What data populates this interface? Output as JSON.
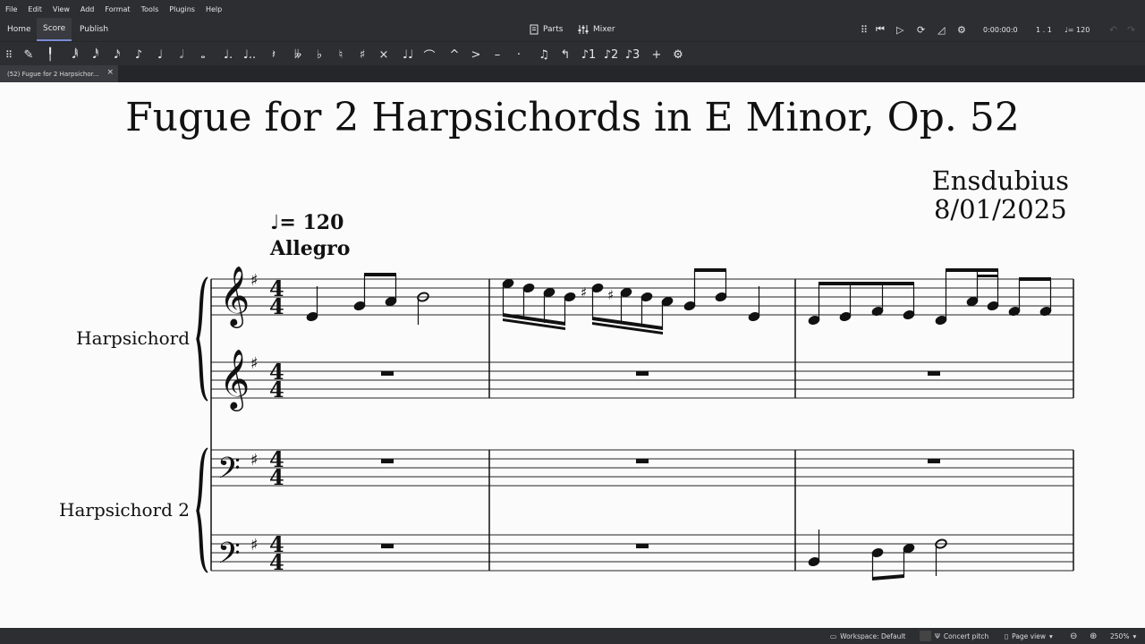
{
  "menu": [
    "File",
    "Edit",
    "View",
    "Add",
    "Format",
    "Tools",
    "Plugins",
    "Help"
  ],
  "tabs": {
    "home": "Home",
    "score": "Score",
    "publish": "Publish"
  },
  "center": {
    "parts": "Parts",
    "mixer": "Mixer"
  },
  "playback": {
    "time": "0:00:00:0",
    "position": "1 . 1",
    "tempo": "♩= 120"
  },
  "doc_tab": {
    "label": "(52) Fugue for 2 Harpsichor...",
    "close": "×"
  },
  "score": {
    "title": "Fugue for 2 Harpsichords in E Minor, Op. 52",
    "composer": "Ensdubius",
    "date": "8/01/2025",
    "tempo_marking": "= 120",
    "tempo_text": "Allegro",
    "instrument1": "Harpsichord",
    "instrument2": "Harpsichord 2"
  },
  "status": {
    "workspace": "Workspace: Default",
    "concert_pitch": "Concert pitch",
    "view": "Page view",
    "zoom": "250%"
  },
  "colors": {
    "accent": "#7b8bd6",
    "chrome": "#2d2e31",
    "paper": "#fbfbfb"
  }
}
